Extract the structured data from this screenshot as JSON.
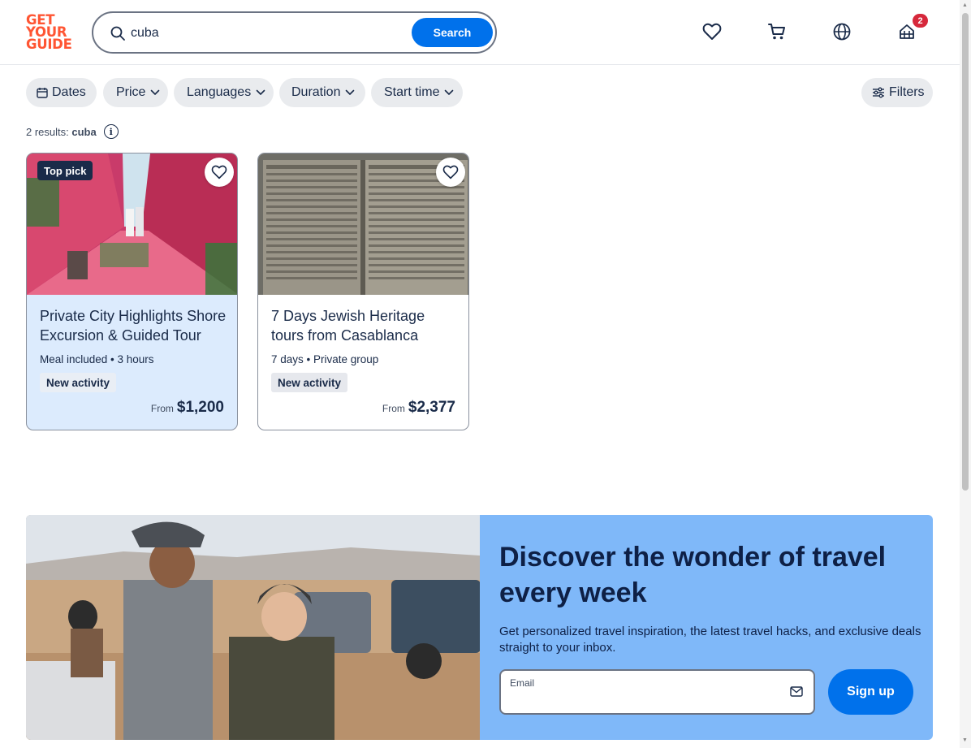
{
  "logo": {
    "line1": "GET",
    "line2": "YOUR",
    "line3": "GUIDE"
  },
  "search": {
    "value": "cuba",
    "placeholder": "Find places and things to do",
    "button": "Search"
  },
  "header": {
    "cart_badge": "2"
  },
  "filters": {
    "dates": "Dates",
    "price": "Price",
    "languages": "Languages",
    "duration": "Duration",
    "start_time": "Start time",
    "more": "Filters"
  },
  "results": {
    "label": "2 results:",
    "query": "cuba"
  },
  "cards": [
    {
      "badge": "Top pick",
      "title": "Private City Highlights Shore Excursion & Guided Tour",
      "meta": "Meal included • 3 hours",
      "tag": "New activity",
      "from": "From",
      "price": "$1,200"
    },
    {
      "title": "7 Days Jewish Heritage tours from Casablanca",
      "meta": "7 days • Private group",
      "tag": "New activity",
      "from": "From",
      "price": "$2,377"
    }
  ],
  "newsletter": {
    "title": "Discover the wonder of travel every week",
    "description": "Get personalized travel inspiration, the latest travel hacks, and exclusive deals straight to your inbox.",
    "email_label": "Email",
    "signup": "Sign up"
  },
  "colors": {
    "brand": "#ff5533",
    "primary": "#0071eb",
    "navy": "#1a2b49",
    "newsletter_bg": "#7fb8f9"
  }
}
